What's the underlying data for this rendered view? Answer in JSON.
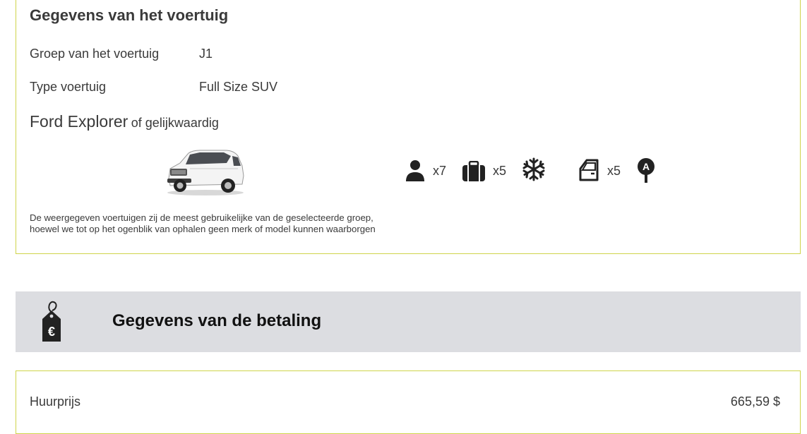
{
  "vehicle": {
    "title": "Gegevens van het voertuig",
    "group_label": "Groep van het voertuig",
    "group_value": "J1",
    "type_label": "Type voertuig",
    "type_value": "Full Size SUV",
    "model_name": "Ford Explorer",
    "model_suffix": "of gelijkwaardig",
    "features": {
      "passengers": "x7",
      "luggage": "x5",
      "air_conditioning_icon": "snowflake-icon",
      "doors": "x5",
      "transmission_icon": "automatic-gear-icon"
    },
    "disclaimer": "De weergegeven voertuigen zij de meest gebruikelijke van de geselecteerde groep, hoewel we tot op het ogenblik van ophalen geen merk of model kunnen waarborgen"
  },
  "payment": {
    "title": "Gegevens van de betaling",
    "icon": "euro-price-tag-icon",
    "rental_price_label": "Huurprijs",
    "rental_price_value": "665,59 $"
  },
  "colors": {
    "card_border": "#cfd44a",
    "header_bg": "#dcdde1",
    "icon_dark": "#222222"
  }
}
